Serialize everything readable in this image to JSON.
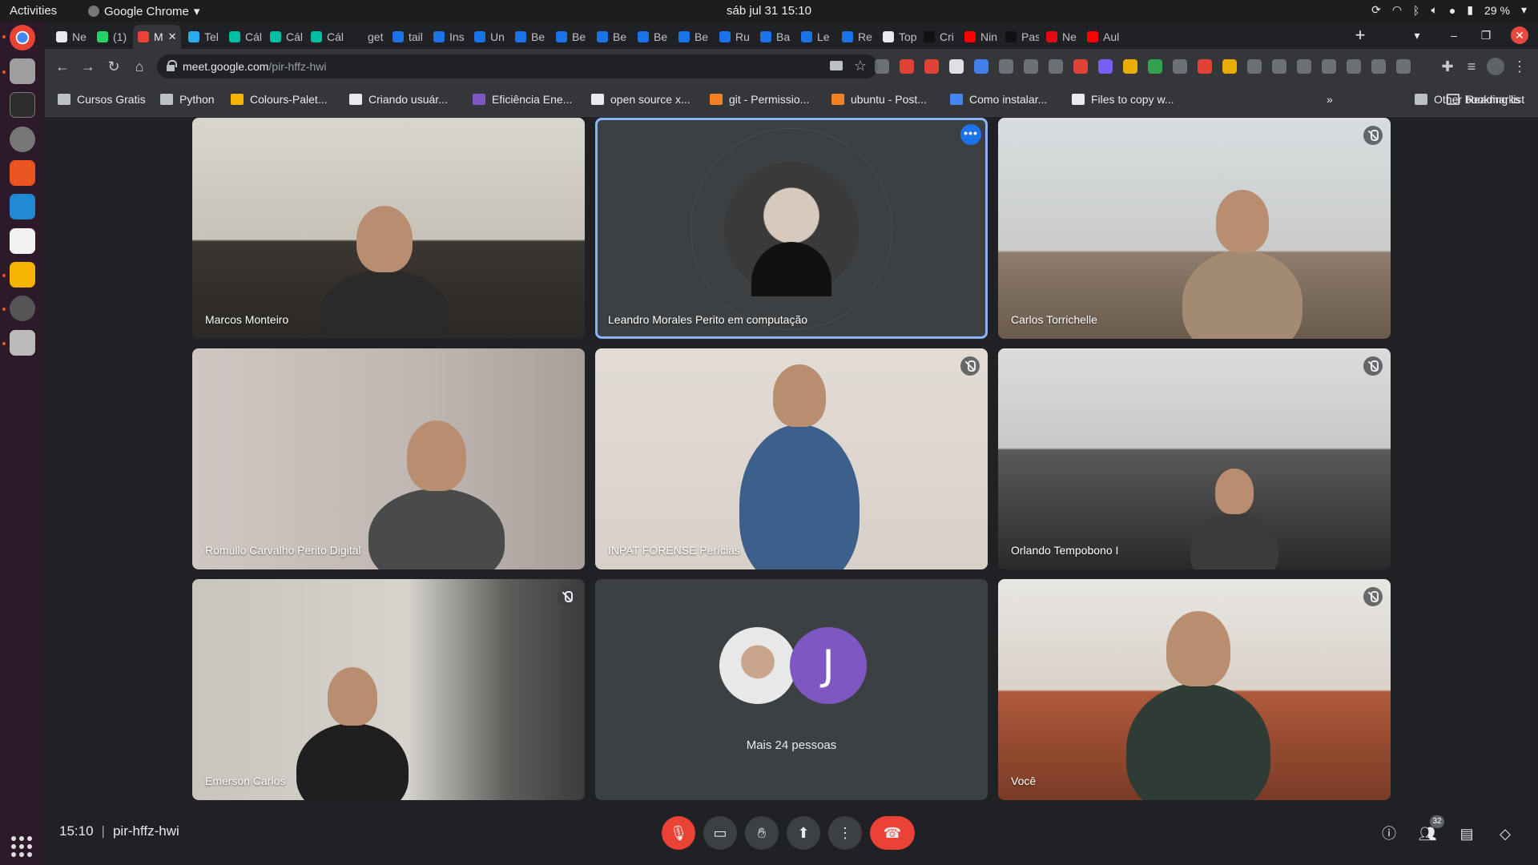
{
  "topbar": {
    "activities": "Activities",
    "app_name": "Google Chrome",
    "clock": "sáb jul 31  15:10",
    "battery": "29 %"
  },
  "tabs": [
    {
      "label": "Ne",
      "color": "#e8eaed"
    },
    {
      "label": "(1)",
      "color": "#25d366"
    },
    {
      "label": "M",
      "color": "#ea4335"
    },
    {
      "label": "Tel",
      "color": "#2aabee"
    },
    {
      "label": "Cál",
      "color": "#00bfa5"
    },
    {
      "label": "Cál",
      "color": "#00bfa5"
    },
    {
      "label": "Cál",
      "color": "#00bfa5"
    },
    {
      "label": "get",
      "color": "#202124"
    },
    {
      "label": "tail",
      "color": "#1a73e8"
    },
    {
      "label": "Ins",
      "color": "#1a73e8"
    },
    {
      "label": "Un",
      "color": "#1a73e8"
    },
    {
      "label": "Be",
      "color": "#1a73e8"
    },
    {
      "label": "Be",
      "color": "#1a73e8"
    },
    {
      "label": "Be",
      "color": "#1a73e8"
    },
    {
      "label": "Be",
      "color": "#1a73e8"
    },
    {
      "label": "Be",
      "color": "#1a73e8"
    },
    {
      "label": "Ru",
      "color": "#1a73e8"
    },
    {
      "label": "Ba",
      "color": "#1a73e8"
    },
    {
      "label": "Le",
      "color": "#1a73e8"
    },
    {
      "label": "Re",
      "color": "#1a73e8"
    },
    {
      "label": "Top",
      "color": "#e8eaed"
    },
    {
      "label": "Cri",
      "color": "#111111"
    },
    {
      "label": "Nin",
      "color": "#ff0000"
    },
    {
      "label": "Pas",
      "color": "#111111"
    },
    {
      "label": "Ne",
      "color": "#e50914"
    },
    {
      "label": "Aul",
      "color": "#ff0000"
    }
  ],
  "address": {
    "host": "meet.google.com",
    "path": "/pir-hffz-hwi"
  },
  "bookmarks": [
    {
      "label": "Cursos Gratis",
      "icon": "folder-icon"
    },
    {
      "label": "Python",
      "icon": "folder-icon"
    },
    {
      "label": "Colours-Palet...",
      "icon": "palette-icon"
    },
    {
      "label": "Criando usuár...",
      "icon": "page-icon"
    },
    {
      "label": "Eficiência Ene...",
      "icon": "b-icon"
    },
    {
      "label": "open source x...",
      "icon": "fork-icon"
    },
    {
      "label": "git - Permissio...",
      "icon": "stack-icon"
    },
    {
      "label": "ubuntu - Post...",
      "icon": "stack-icon"
    },
    {
      "label": "Como instalar...",
      "icon": "ring-icon"
    },
    {
      "label": "Files to copy w...",
      "icon": "page-icon"
    }
  ],
  "bookmarks_right": {
    "overflow": "»",
    "other": "Other bookmarks",
    "reading": "Reading list"
  },
  "participants": [
    {
      "name": "Marcos Monteiro",
      "muted": false,
      "speaking": false
    },
    {
      "name": "Leandro Morales Perito em computação",
      "muted": false,
      "speaking": true
    },
    {
      "name": "Carlos Torrichelle",
      "muted": true,
      "speaking": false
    },
    {
      "name": "Romullo Carvalho Perito Digital",
      "muted": false,
      "speaking": false
    },
    {
      "name": "INPAT FORENSE Perícias",
      "muted": true,
      "speaking": false
    },
    {
      "name": "Orlando Tempobono I",
      "muted": true,
      "speaking": false
    },
    {
      "name": "Emerson Carlos",
      "muted": true,
      "speaking": false
    },
    {
      "name": "Você",
      "muted": true,
      "speaking": false
    }
  ],
  "overflow_tile": {
    "initial": "J",
    "label": "Mais 24 pessoas"
  },
  "bottombar": {
    "time": "15:10",
    "meeting_code": "pir-hffz-hwi",
    "participant_count": "32"
  },
  "colors": {
    "meet_bg": "#202124",
    "accent": "#8ab4f8",
    "danger": "#ea4335"
  }
}
